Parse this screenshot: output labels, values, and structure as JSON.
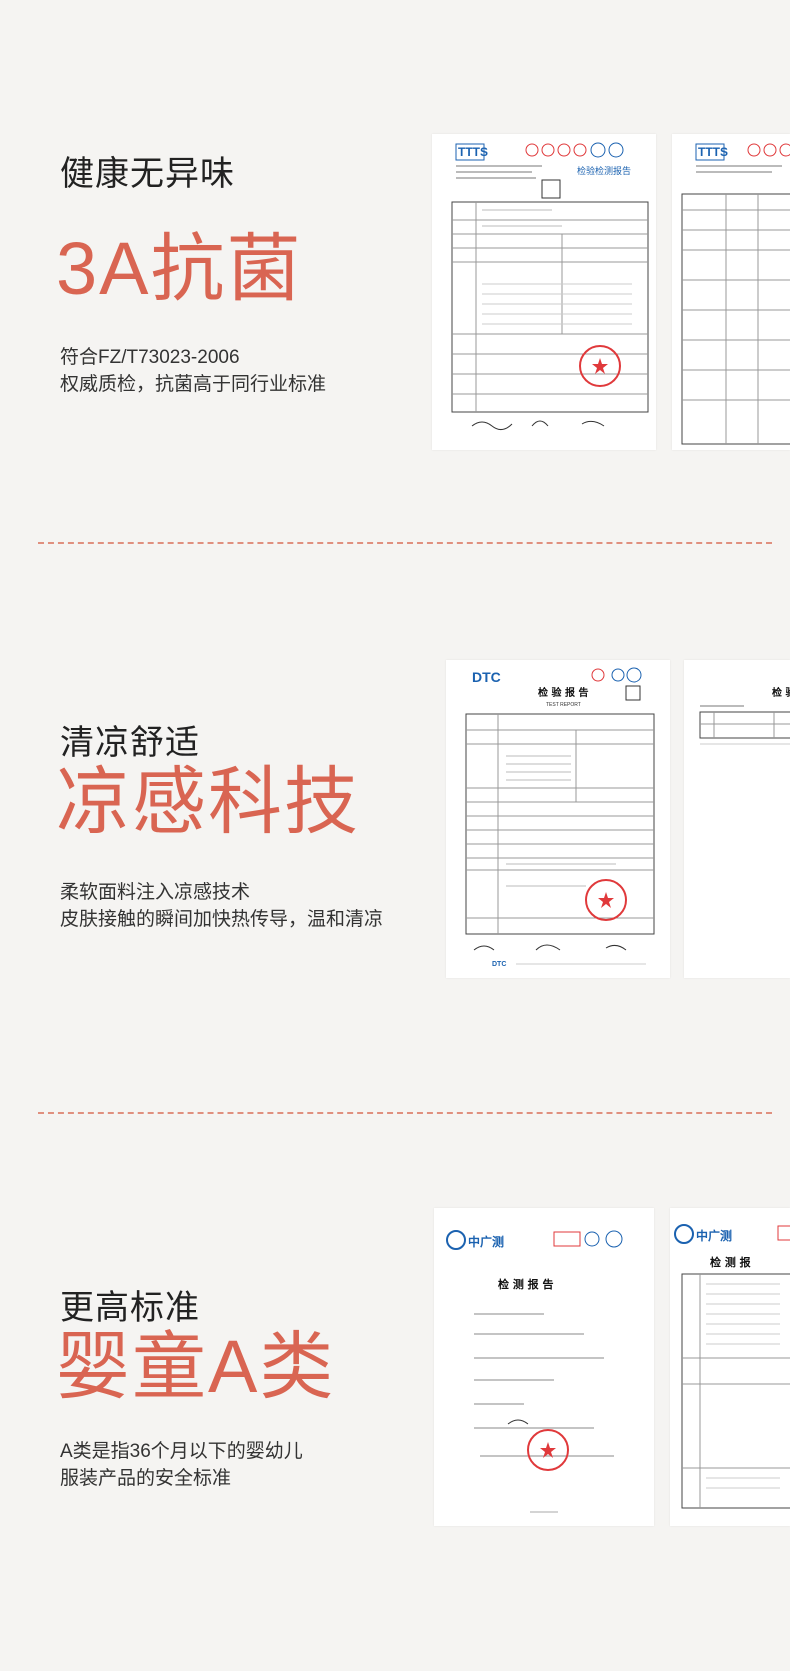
{
  "sections": [
    {
      "subtitle": "健康无异味",
      "headline": "3A抗菌",
      "desc_line1": "符合FZ/T73023-2006",
      "desc_line2": "权威质检，抗菌高于同行业标准",
      "doc1_header": "检验检测报告",
      "doc1_logo": "TTTS",
      "doc2_logo": "TTTS"
    },
    {
      "subtitle": "清凉舒适",
      "headline": "凉感科技",
      "desc_line1": "柔软面料注入凉感技术",
      "desc_line2": "皮肤接触的瞬间加快热传导，温和清凉",
      "doc1_logo": "DTC",
      "doc1_header": "检 验 报 告",
      "doc1_subheader": "TEST REPORT",
      "doc2_header": "检 验",
      "doc_footer_logo": "DTC"
    },
    {
      "subtitle": "更高标准",
      "headline": "婴童A类",
      "desc_line1": "A类是指36个月以下的婴幼儿",
      "desc_line2": "服装产品的安全标准",
      "doc1_logo": "中广测",
      "doc1_header": "检 测 报 告",
      "doc2_logo": "中广测",
      "doc2_header": "检 测 报"
    }
  ],
  "colors": {
    "accent": "#d96552",
    "divider": "#e0907f",
    "background": "#f5f4f2",
    "stamp_red": "#e0393b",
    "logo_blue": "#1b62b0"
  }
}
